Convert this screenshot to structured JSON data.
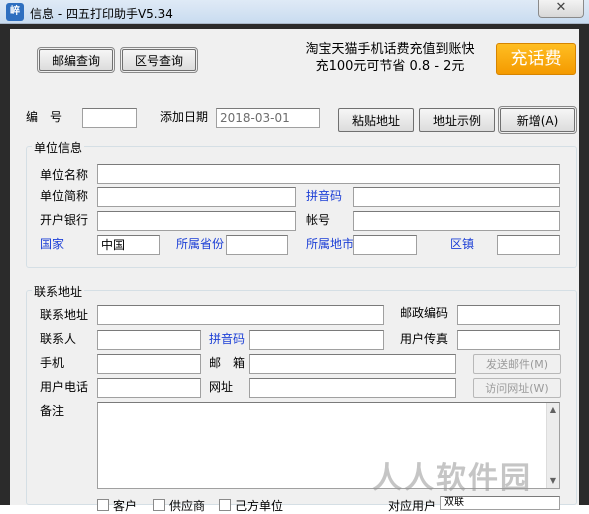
{
  "window": {
    "title": "信息 - 四五打印助手V5.34",
    "icon_text": "崪",
    "close_symbol": "✕"
  },
  "toolbar": {
    "postcode_lookup": "邮编查询",
    "areacode_lookup": "区号查询",
    "ad_line1": "淘宝天猫手机话费充值到账快",
    "ad_line2": "充100元可节省 0.8 - 2元",
    "ad_button": "充话费"
  },
  "header_row": {
    "number_label": "编　号",
    "number_value": "",
    "add_date_label": "添加日期",
    "add_date_value": "2018-03-01",
    "paste_address": "粘贴地址",
    "address_example": "地址示例",
    "add_new": "新增(A)"
  },
  "unit_info": {
    "title": "单位信息",
    "unit_name_label": "单位名称",
    "unit_abbr_label": "单位简称",
    "pinyin_label": "拼音码",
    "bank_label": "开户银行",
    "account_label": "帐号",
    "country_label": "国家",
    "country_value": "中国",
    "province_label": "所属省份",
    "city_label": "所属地市",
    "district_label": "区镇"
  },
  "contact": {
    "title": "联系地址",
    "address_label": "联系地址",
    "postcode_label": "邮政编码",
    "person_label": "联系人",
    "pinyin_label": "拼音码",
    "fax_label": "用户传真",
    "mobile_label": "手机",
    "email_label": "邮　箱",
    "send_mail": "发送邮件(M)",
    "phone_label": "用户电话",
    "website_label": "网址",
    "visit_site": "访问网址(W)",
    "note_label": "备注"
  },
  "bottom_row": {
    "customer": "客户",
    "supplier": "供应商",
    "own_unit": "己方单位",
    "paper_label": "对应用户",
    "paper_value": "双联"
  },
  "watermark": "人人软件园",
  "colors": {
    "link_blue": "#1c3fd6",
    "ad_orange": "#f49a00",
    "frame_dark": "#2b2b2b"
  }
}
